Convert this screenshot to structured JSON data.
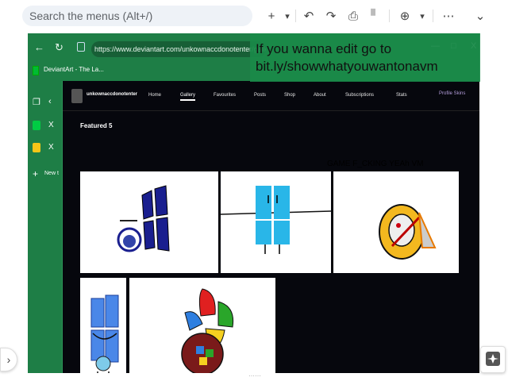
{
  "toolbar": {
    "search_placeholder": "Search the menus (Alt+/)",
    "plus": "+",
    "caret": "▾",
    "undo": "↶",
    "redo": "↷",
    "print": "⎙",
    "paint": "▘",
    "zoom": "⊕",
    "more": "⋯",
    "collapse": "⌄"
  },
  "browser": {
    "url": "https://www.deviantart.com/unkownaccdonotenter/gallery",
    "tab_title": "DeviantArt - The La...",
    "new_tab_label": "New t",
    "close_label": "X",
    "back": "←",
    "reload": "↻",
    "minimize": "—",
    "maximize": "□",
    "close": "X"
  },
  "deviantart": {
    "username": "unkownaccdonotenter",
    "nav": [
      "Home",
      "Gallery",
      "Favourites",
      "Posts",
      "Shop",
      "About",
      "Subscriptions",
      "Stats"
    ],
    "profile_skins": "Profile Skins",
    "featured": "Featured 5"
  },
  "overlay": {
    "line1": "If you wanna edit go to",
    "line2": "bit.ly/showwhatyouwantonavm"
  },
  "caption": "GAME F_CKING YEAh VM",
  "colors": {
    "browser_green": "#1e7e46",
    "da_bg": "#06070d",
    "accent": "#b39ddb"
  }
}
